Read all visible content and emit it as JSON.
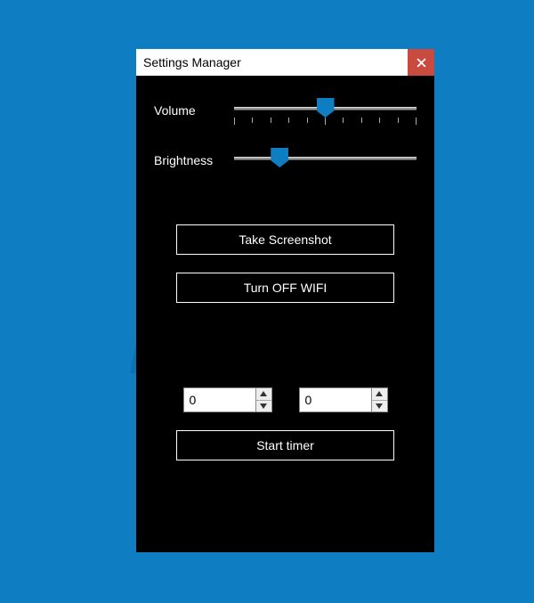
{
  "watermark": {
    "brand_top": "PC",
    "brand_bottom": "risk.com"
  },
  "window": {
    "title": "Settings Manager",
    "close_label": "Close"
  },
  "sliders": {
    "volume": {
      "label": "Volume",
      "position_pct": 50
    },
    "brightness": {
      "label": "Brightness",
      "position_pct": 25
    }
  },
  "buttons": {
    "screenshot": "Take Screenshot",
    "wifi": "Turn OFF WIFI",
    "start_timer": "Start timer"
  },
  "spinners": {
    "left": {
      "value": "0"
    },
    "right": {
      "value": "0"
    }
  },
  "colors": {
    "desktop_bg": "#0e7dc2",
    "accent": "#0e7dc2",
    "close_btn": "#c94b3f"
  }
}
